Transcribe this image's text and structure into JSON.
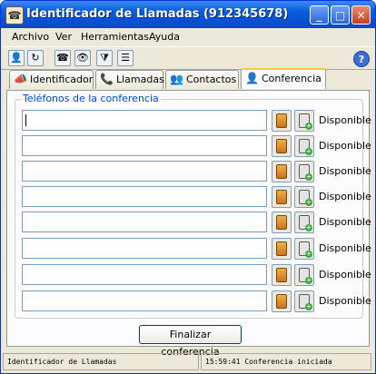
{
  "window": {
    "title": "Identificador de Llamadas (912345678)",
    "minimize": "_",
    "maximize": "□",
    "close": "✕"
  },
  "menu": [
    "Archivo",
    "Ver",
    "Herramientas",
    "Ayuda"
  ],
  "toolbar": {
    "icons": [
      "user-icon",
      "refresh-icon",
      "phone-icon",
      "eye-icon",
      "filter-icon",
      "list-icon"
    ],
    "glyphs": [
      "👤",
      "↻",
      "☎",
      "👁",
      "⧩",
      "☰"
    ],
    "help_icon": "help-icon",
    "help_glyph": "?"
  },
  "tabs": [
    {
      "label": "Identificador",
      "icon": "megaphone-icon",
      "glyph": "📣"
    },
    {
      "label": "Llamadas",
      "icon": "calls-icon",
      "glyph": "📞"
    },
    {
      "label": "Contactos",
      "icon": "contacts-icon",
      "glyph": "👥"
    },
    {
      "label": "Conferencia",
      "icon": "conference-icon",
      "glyph": "👤",
      "active": true
    }
  ],
  "conference": {
    "group_label": "Teléfonos de la conferencia",
    "rows": [
      {
        "value": "",
        "status": "Disponible"
      },
      {
        "value": "",
        "status": "Disponible"
      },
      {
        "value": "",
        "status": "Disponible"
      },
      {
        "value": "",
        "status": "Disponible"
      },
      {
        "value": "",
        "status": "Disponible"
      },
      {
        "value": "",
        "status": "Disponible"
      },
      {
        "value": "",
        "status": "Disponible"
      },
      {
        "value": "",
        "status": "Disponible"
      }
    ],
    "finish_button": "Finalizar conferencia"
  },
  "statusbar": {
    "left": "Identificador de Llamadas",
    "right": "15:59:41 Conferencia iniciada"
  },
  "colors": {
    "titlebar": "#0553d6",
    "group_label": "#0046d5",
    "active_tab_highlight": "#ffc83c"
  }
}
